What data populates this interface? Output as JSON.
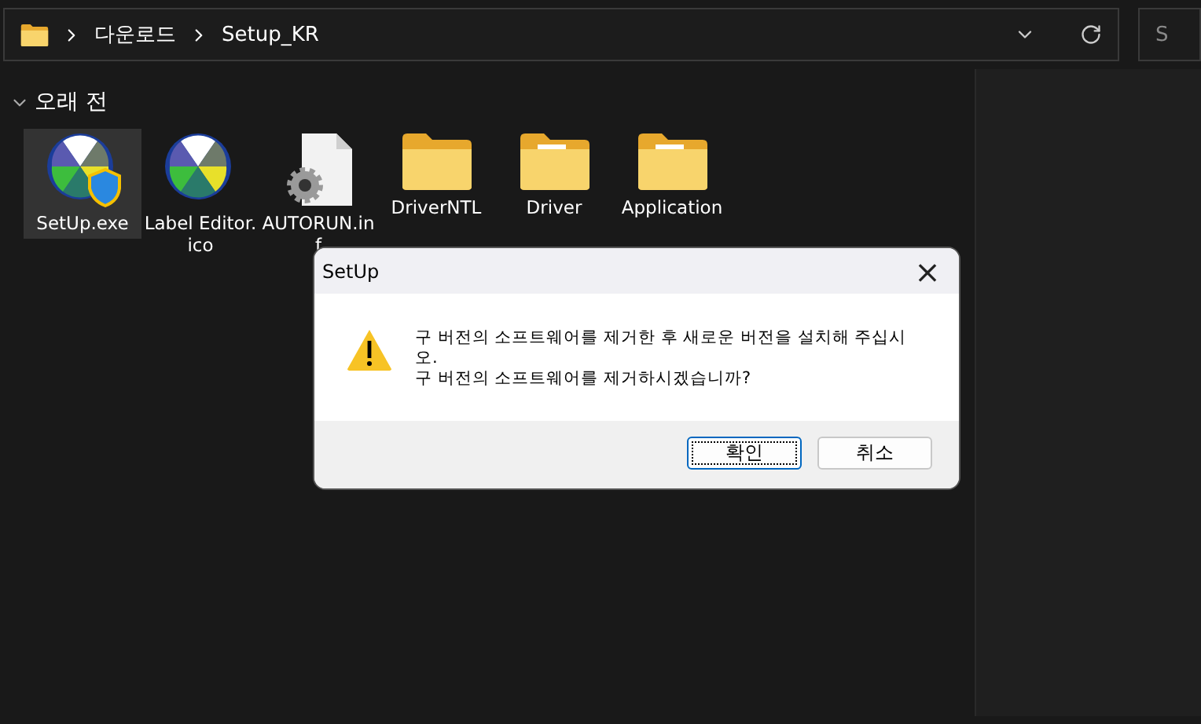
{
  "address_bar": {
    "path": [
      {
        "label": "다운로드"
      },
      {
        "label": "Setup_KR"
      }
    ]
  },
  "search": {
    "placeholder": "S"
  },
  "group": {
    "title": "오래 전",
    "expanded": true
  },
  "files": [
    {
      "name": "SetUp.exe",
      "kind": "setup",
      "selected": true
    },
    {
      "name": "Label Editor.ico",
      "kind": "app",
      "selected": false
    },
    {
      "name": "AUTORUN.inf",
      "kind": "config",
      "selected": false
    },
    {
      "name": "DriverNTL",
      "kind": "folder",
      "selected": false
    },
    {
      "name": "Driver",
      "kind": "folder-docs",
      "selected": false
    },
    {
      "name": "Application",
      "kind": "folder-docs",
      "selected": false
    }
  ],
  "dialog": {
    "title": "SetUp",
    "close": "×",
    "message": [
      "구 버전의 소프트웨어를 제거한 후 새로운 버전을 설치해 주십시오.",
      "구 버전의 소프트웨어를 제거하시겠습니까?"
    ],
    "buttons": [
      {
        "label": "확인",
        "selected": true
      },
      {
        "label": "취소",
        "selected": false
      }
    ]
  }
}
